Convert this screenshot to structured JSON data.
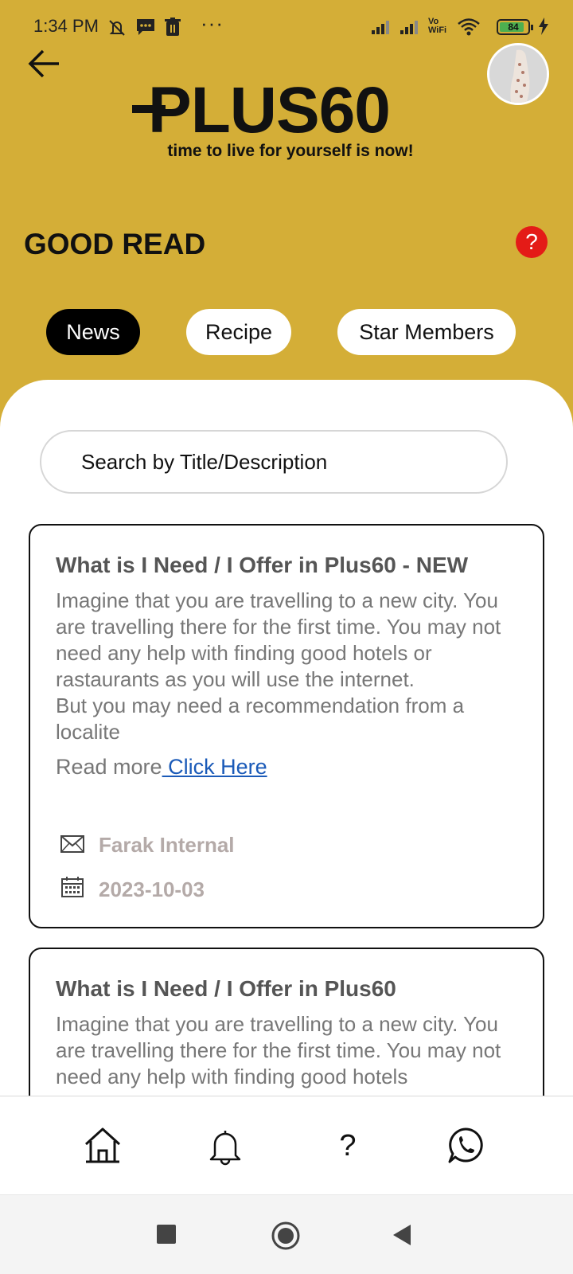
{
  "status_bar": {
    "time": "1:34 PM",
    "battery_level": "84",
    "vowifi_label": "Vo WiFi"
  },
  "header": {
    "logo_text": "PLUS60",
    "tagline": "time to live for yourself is now!",
    "section_title": "GOOD READ",
    "help_icon": "?"
  },
  "tabs": [
    {
      "label": "News",
      "active": true
    },
    {
      "label": "Recipe",
      "active": false
    },
    {
      "label": "Star Members",
      "active": false
    }
  ],
  "search": {
    "placeholder": "Search by Title/Description",
    "value": ""
  },
  "articles": [
    {
      "title": "What is I Need / I Offer in Plus60 - NEW",
      "description": "Imagine that you are travelling to a new city. You are travelling there for the first time. You may not need any help with finding good hotels or rastaurants as you will use the internet.\nBut you may need a recommendation from a localite",
      "read_more_prefix": "Read more",
      "read_more_link": " Click Here",
      "author": "Farak Internal",
      "date": "2023-10-03"
    },
    {
      "title": "What is I Need / I Offer in Plus60",
      "description": "Imagine that you are travelling to a new city. You are travelling there for the first time. You may not need any help with finding good hotels"
    }
  ],
  "bottom_nav": {
    "items": [
      "home-icon",
      "bell-icon",
      "question-icon",
      "whatsapp-icon"
    ],
    "question_glyph": "?"
  },
  "colors": {
    "header_bg": "#d4ae37",
    "active_tab_bg": "#000000",
    "help_badge": "#e41b17",
    "link": "#1a5ab8"
  }
}
